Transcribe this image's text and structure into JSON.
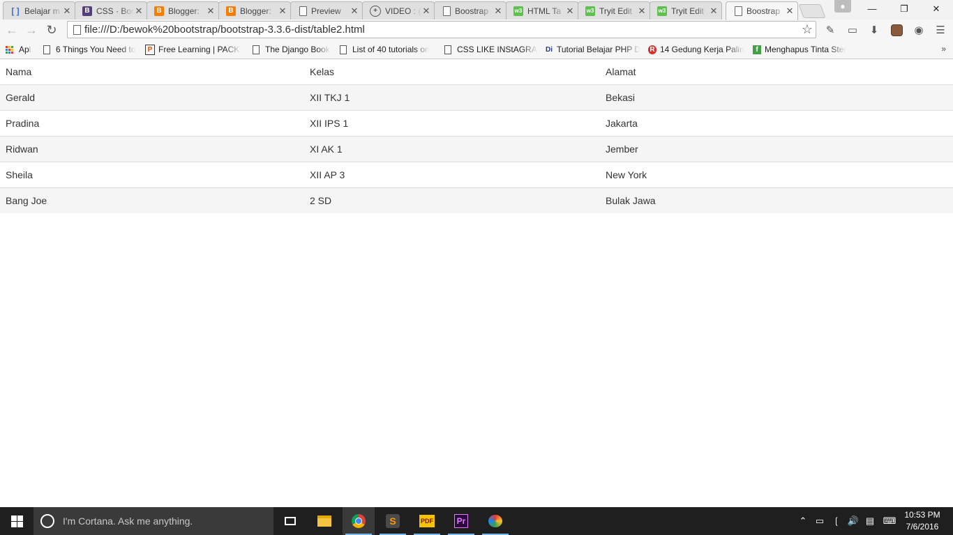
{
  "tabs": [
    {
      "title": "Belajar m",
      "icon": "brackets-icon"
    },
    {
      "title": "CSS · Boo",
      "icon": "bootstrap-icon"
    },
    {
      "title": "Blogger:",
      "icon": "blogger-icon"
    },
    {
      "title": "Blogger:",
      "icon": "blogger-icon"
    },
    {
      "title": "Preview",
      "icon": "page-icon"
    },
    {
      "title": "VIDEO : (",
      "icon": "plus-circle-icon"
    },
    {
      "title": "Boostrap",
      "icon": "page-icon"
    },
    {
      "title": "HTML Ta",
      "icon": "w3schools-icon"
    },
    {
      "title": "Tryit Edit",
      "icon": "w3schools-icon"
    },
    {
      "title": "Tryit Edit",
      "icon": "w3schools-icon"
    },
    {
      "title": "Boostrap",
      "icon": "page-icon",
      "active": true
    }
  ],
  "address_bar": {
    "url": "file:///D:/bewok%20bootstrap/bootstrap-3.3.6-dist/table2.html"
  },
  "bookmarks": [
    {
      "label": "Apl",
      "icon": "apps-icon"
    },
    {
      "label": "6 Things You Need to",
      "icon": "page-icon"
    },
    {
      "label": "Free Learning | PACKT",
      "icon": "packt-icon"
    },
    {
      "label": "The Django Book",
      "icon": "page-icon"
    },
    {
      "label": "List of 40 tutorials on",
      "icon": "page-icon"
    },
    {
      "label": "CSS LIKE INStAGRAM",
      "icon": "page-icon"
    },
    {
      "label": "Tutorial Belajar PHP D",
      "icon": "di-icon"
    },
    {
      "label": "14 Gedung Kerja Palin",
      "icon": "r-icon"
    },
    {
      "label": "Menghapus Tinta Ster",
      "icon": "green-icon"
    }
  ],
  "table": {
    "headers": [
      "Nama",
      "Kelas",
      "Alamat"
    ],
    "rows": [
      [
        "Gerald",
        "XII TKJ 1",
        "Bekasi"
      ],
      [
        "Pradina",
        "XII IPS 1",
        "Jakarta"
      ],
      [
        "Ridwan",
        "XI AK 1",
        "Jember"
      ],
      [
        "Sheila",
        "XII AP 3",
        "New York"
      ],
      [
        "Bang Joe",
        "2 SD",
        "Bulak Jawa"
      ]
    ]
  },
  "taskbar": {
    "search_placeholder": "I'm Cortana. Ask me anything.",
    "time": "10:53 PM",
    "date": "7/6/2016",
    "apps": [
      "task-view-icon",
      "file-explorer-icon",
      "chrome-icon",
      "sublime-text-icon",
      "pdf-icon",
      "premiere-icon",
      "paint-icon"
    ]
  },
  "colors": {
    "accent": "#76b9ed",
    "taskbar": "#1f1f1f",
    "stripe": "#f5f5f5"
  }
}
